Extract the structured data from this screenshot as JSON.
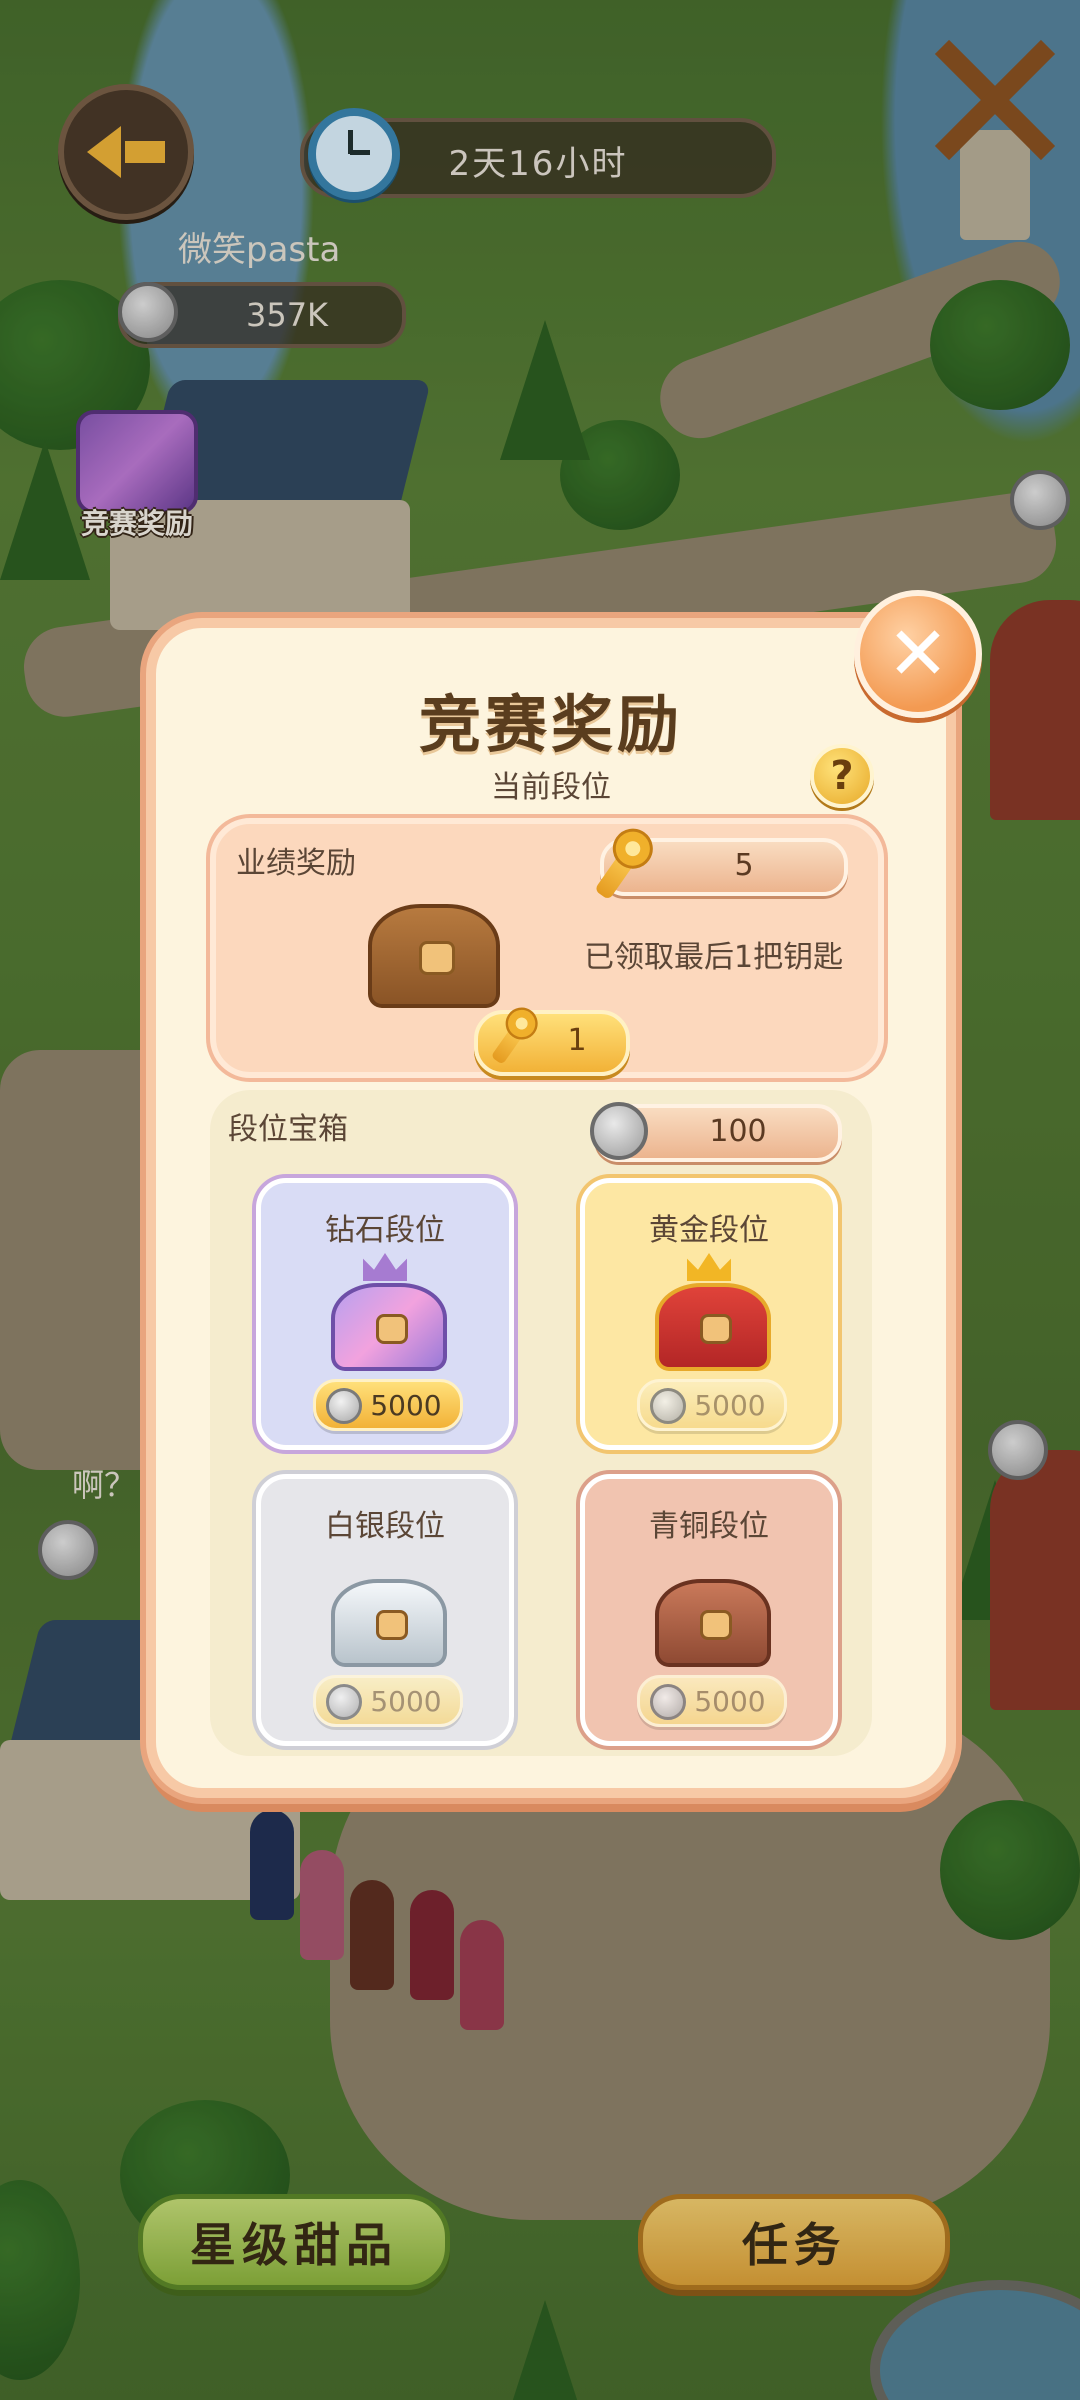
{
  "hud": {
    "timer": "2天16小时",
    "player_name": "微笑pasta",
    "coins": "357K",
    "side_reward_label": "竞赛奖励",
    "side_text": "啊？"
  },
  "bottom_buttons": {
    "star_desserts": "星级甜品",
    "tasks": "任务"
  },
  "modal": {
    "title": "竞赛奖励",
    "subtitle": "当前段位",
    "performance": {
      "label": "业绩奖励",
      "key_count": "5",
      "status": "已领取最后1把钥匙",
      "claim_value": "1"
    },
    "rank_chests": {
      "label": "段位宝箱",
      "coin_amount": "100",
      "tiers": [
        {
          "name": "钻石段位",
          "price": "5000",
          "color": "#d9dcf5"
        },
        {
          "name": "黄金段位",
          "price": "5000",
          "color": "#fde7a3"
        },
        {
          "name": "白银段位",
          "price": "5000",
          "color": "#e6e6ea"
        },
        {
          "name": "青铜段位",
          "price": "5000",
          "color": "#f1c4b0"
        }
      ]
    }
  },
  "colors": {
    "accent_orange": "#f39a52",
    "panel_cream": "#fdf4de",
    "text_brown": "#5b4636"
  }
}
